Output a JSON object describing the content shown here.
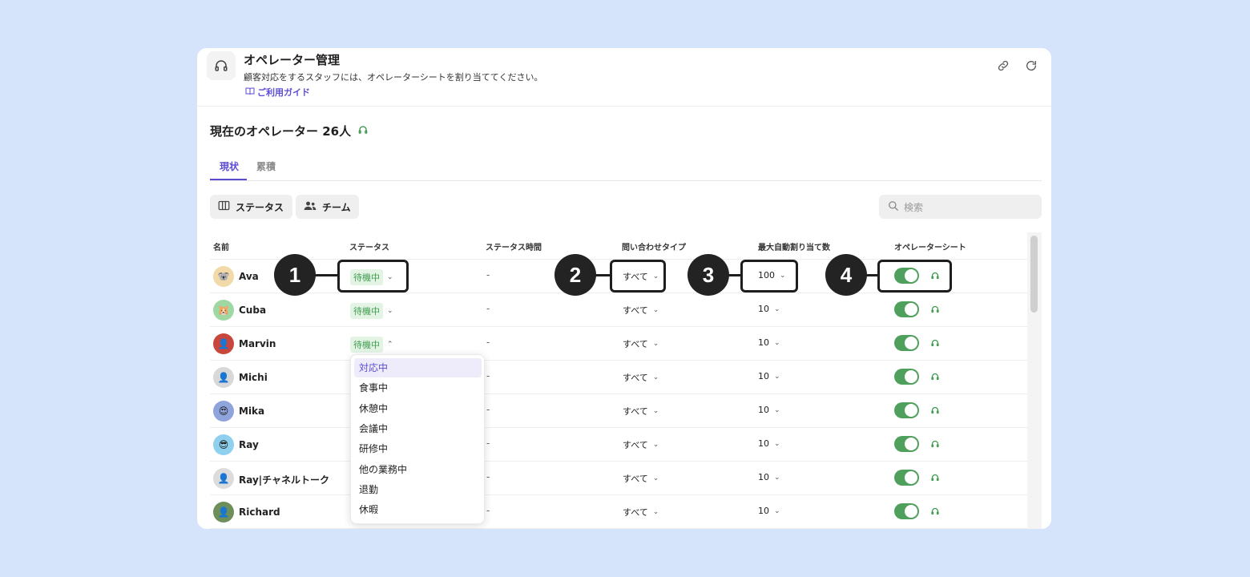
{
  "header": {
    "title": "オペレーター管理",
    "description": "顧客対応をするスタッフには、オペレーターシートを割り当ててください。",
    "guide_link": "ご利用ガイド"
  },
  "operators_title": "現在のオペレーター 26人",
  "tabs": [
    "現状",
    "累積"
  ],
  "toolbar": {
    "status_button": "ステータス",
    "team_button": "チーム",
    "search_placeholder": "検索"
  },
  "columns": [
    "名前",
    "ステータス",
    "ステータス時間",
    "問い合わせタイプ",
    "最大自動割り当て数",
    "オペレーターシート"
  ],
  "rows": [
    {
      "name": "Ava",
      "status": "待機中",
      "status_time": "-",
      "inquiry_type": "すべて",
      "max_assign": "100",
      "seat_on": true,
      "avatar_emoji": "🐨",
      "avatar_color": "#f2d9a8"
    },
    {
      "name": "Cuba",
      "status": "待機中",
      "status_time": "-",
      "inquiry_type": "すべて",
      "max_assign": "10",
      "seat_on": true,
      "avatar_emoji": "🐹",
      "avatar_color": "#9fd8a3"
    },
    {
      "name": "Marvin",
      "status": "待機中",
      "status_time": "-",
      "inquiry_type": "すべて",
      "max_assign": "10",
      "seat_on": true,
      "avatar_emoji": "👤",
      "avatar_color": "#c9463c"
    },
    {
      "name": "Michi",
      "status": "",
      "status_time": "-",
      "inquiry_type": "すべて",
      "max_assign": "10",
      "seat_on": true,
      "avatar_emoji": "👤",
      "avatar_color": "#d8d8d8"
    },
    {
      "name": "Mika",
      "status": "",
      "status_time": "-",
      "inquiry_type": "すべて",
      "max_assign": "10",
      "seat_on": true,
      "avatar_emoji": "😍",
      "avatar_color": "#8fa3dc"
    },
    {
      "name": "Ray",
      "status": "",
      "status_time": "-",
      "inquiry_type": "すべて",
      "max_assign": "10",
      "seat_on": true,
      "avatar_emoji": "😎",
      "avatar_color": "#8fd0ef"
    },
    {
      "name": "Ray|チャネルトーク",
      "status": "",
      "status_time": "-",
      "inquiry_type": "すべて",
      "max_assign": "10",
      "seat_on": true,
      "avatar_emoji": "👤",
      "avatar_color": "#dcdcdc"
    },
    {
      "name": "Richard",
      "status": "",
      "status_time": "-",
      "inquiry_type": "すべて",
      "max_assign": "10",
      "seat_on": true,
      "avatar_emoji": "👤",
      "avatar_color": "#6e8f5a"
    }
  ],
  "status_menu": {
    "options": [
      "対応中",
      "食事中",
      "休憩中",
      "会議中",
      "研修中",
      "他の業務中",
      "退勤",
      "休暇"
    ],
    "highlighted": "対応中"
  },
  "callouts": [
    "1",
    "2",
    "3",
    "4"
  ],
  "colors": {
    "accent": "#5b4cd6",
    "toggle_on": "#4f9f5d",
    "badge_bg": "#e3f4e5",
    "badge_text": "#3f9c4f"
  }
}
